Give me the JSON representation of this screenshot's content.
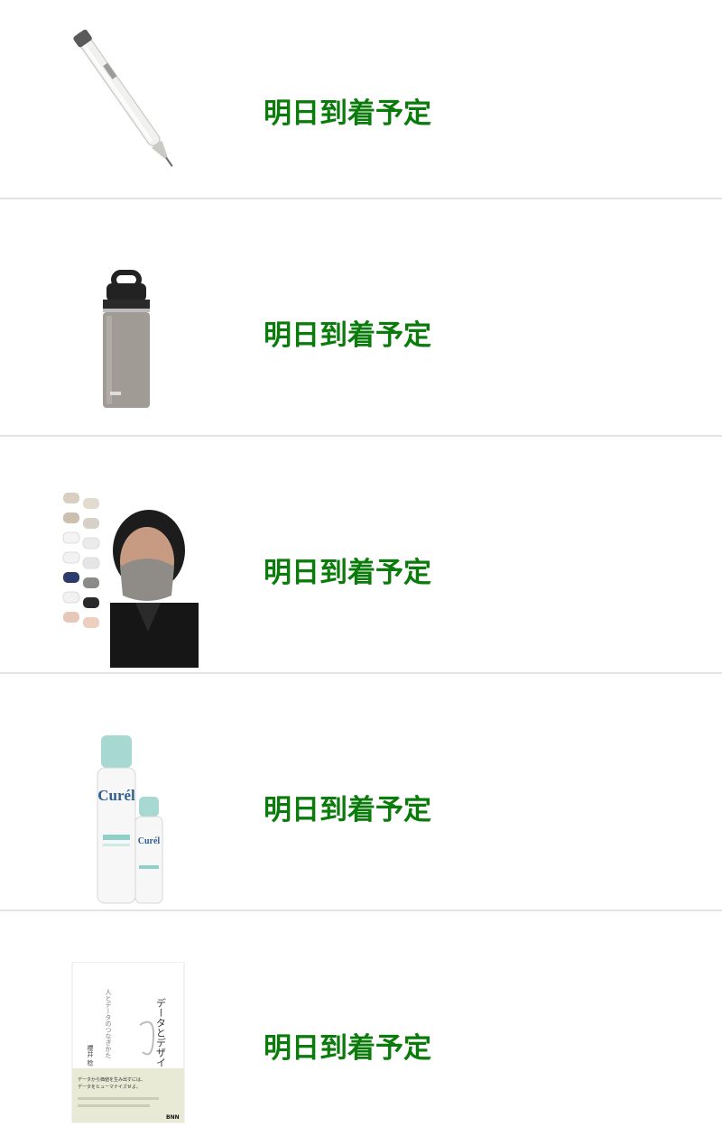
{
  "colors": {
    "status": "#0b7c0b",
    "divider": "#e3e3e3",
    "background": "#ffffff"
  },
  "items": [
    {
      "product": "multi-pen",
      "image": "pen-image",
      "status": "明日到着予定"
    },
    {
      "product": "bottle",
      "image": "bottle-image",
      "status": "明日到着予定"
    },
    {
      "product": "face-masks",
      "image": "mask-image",
      "status": "明日到着予定"
    },
    {
      "product": "spray",
      "image": "spray-image",
      "status": "明日到着予定",
      "brand": "Curél"
    },
    {
      "product": "book",
      "image": "book-image",
      "status": "明日到着予定",
      "book": {
        "title": "データとデザイン",
        "subtitle": "人とデータのつなぎかた",
        "author": "櫻井 稔",
        "tagline": "データから価値を生み出すには、データをヒューマナイズせよ。",
        "publisher": "BNN"
      }
    }
  ]
}
